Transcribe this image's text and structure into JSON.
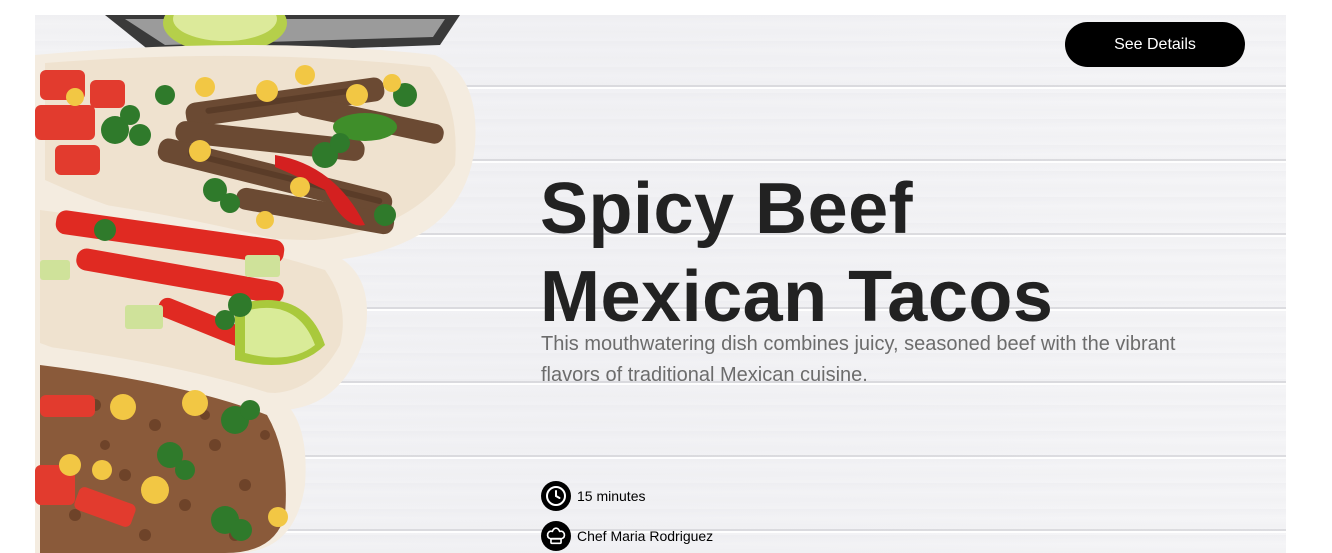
{
  "hero": {
    "button_label": "See Details",
    "title": "Spicy Beef Mexican Tacos",
    "description": "This mouthwatering dish combines juicy, seasoned beef with the vibrant flavors of traditional Mexican cuisine."
  },
  "meta": {
    "time": {
      "icon": "clock-icon",
      "text": "15 minutes"
    },
    "chef": {
      "icon": "chef-hat-icon",
      "text": "Chef Maria Rodriguez"
    }
  },
  "colors": {
    "button_bg": "#000000",
    "title": "#222222",
    "description": "#6c6c6c"
  }
}
